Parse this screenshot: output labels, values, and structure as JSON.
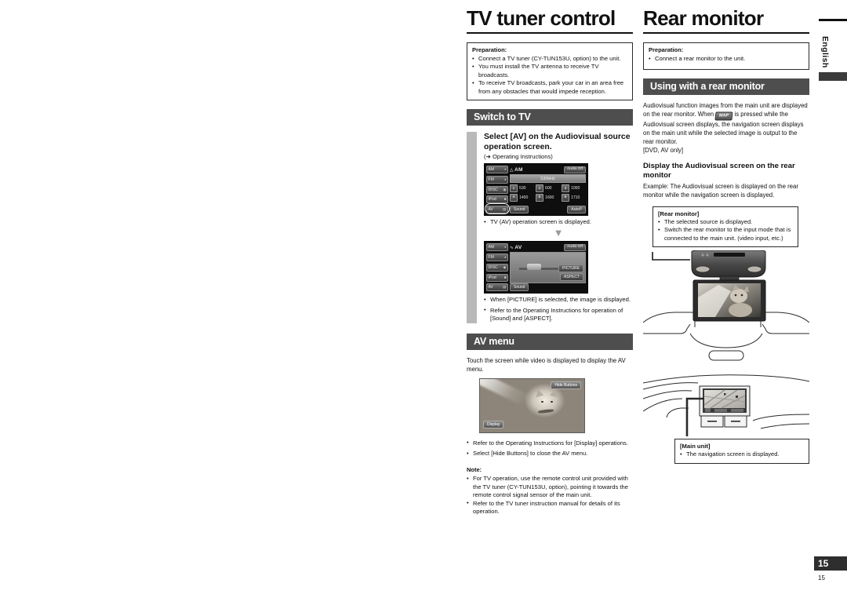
{
  "meta": {
    "side_tab_label": "English",
    "page_number_tab": "15",
    "page_number_footer": "15"
  },
  "left_column": {
    "chapter_title": "TV tuner control",
    "preparation": {
      "title": "Preparation:",
      "items": [
        "Connect a TV tuner (CY-TUN153U, option) to the unit.",
        "You must install the TV antenna to receive TV broadcasts.",
        "To receive TV broadcasts, park your car in an area free from any obstacles that would impede reception."
      ]
    },
    "section_switch": {
      "bar_label": "Switch to TV",
      "step_heading": "Select [AV] on the Audiovisual source operation screen.",
      "reference": "(➜ Operating Instructions)",
      "after_am_note": "TV (AV) operation screen is displayed.",
      "after_av_notes": [
        "When [PICTURE] is selected, the image is displayed.",
        "Refer to the Operating Instructions for operation of [Sound] and [ASPECT]."
      ]
    },
    "am_screen": {
      "sources": [
        "AM",
        "FM",
        "DISC",
        "iPod",
        "AV"
      ],
      "selected_source": "AV",
      "band_label": "AM",
      "audio_button": "Audio Off",
      "frequency": "530kHz",
      "presets": [
        {
          "num": "1",
          "value": "530"
        },
        {
          "num": "2",
          "value": "600"
        },
        {
          "num": "3",
          "value": "1000"
        },
        {
          "num": "4",
          "value": "1400"
        },
        {
          "num": "5",
          "value": "1600"
        },
        {
          "num": "6",
          "value": "1710"
        }
      ],
      "sound_button": "Sound",
      "auto_button": "AutoP"
    },
    "av_screen": {
      "sources": [
        "AM",
        "FM",
        "DISC",
        "iPod",
        "AV"
      ],
      "selected_source": "AV",
      "band_label": "AV",
      "audio_button": "Audio Off",
      "sound_button": "Sound",
      "picture_button": "PICTURE",
      "aspect_button": "ASPECT"
    },
    "section_av_menu": {
      "bar_label": "AV menu",
      "intro": "Touch the screen while video is displayed to display the AV menu.",
      "photo_buttons": {
        "hide_buttons": "Hide Buttons",
        "display": "Display"
      },
      "notes": [
        "Refer to the Operating Instructions for [Display] operations.",
        "Select [Hide Buttons] to close the AV menu."
      ]
    },
    "note_block": {
      "title": "Note:",
      "items": [
        "For TV operation, use the remote control unit provided with the TV tuner (CY-TUN153U, option), pointing it towards the remote control signal sensor of the main unit.",
        "Refer to the TV tuner instruction manual for details of its operation."
      ]
    }
  },
  "right_column": {
    "chapter_title": "Rear monitor",
    "preparation": {
      "title": "Preparation:",
      "items": [
        "Connect a rear monitor to the unit."
      ]
    },
    "section_using": {
      "bar_label": "Using with a rear monitor",
      "paragraph_part1": "Audiovisual function images from the main unit are displayed on the rear monitor. When",
      "map_button_label": "MAP",
      "paragraph_part2": "is pressed while the Audiovisual screen displays, the navigation screen displays on the main unit while the selected image is output to the rear monitor.",
      "availability": "[DVD, AV only]",
      "sub_heading": "Display the Audiovisual screen on the rear monitor",
      "example_label": "Example:",
      "example_text": "The Audiovisual screen is displayed on the rear monitor while the navigation screen is displayed."
    },
    "rear_monitor_callout": {
      "title": "[Rear monitor]",
      "items": [
        "The selected source is displayed.",
        "Switch the rear monitor to the input mode that is connected to the main unit. (video input, etc.)"
      ]
    },
    "main_unit_callout": {
      "title": "[Main unit]",
      "items": [
        "The navigation screen is displayed."
      ]
    }
  }
}
